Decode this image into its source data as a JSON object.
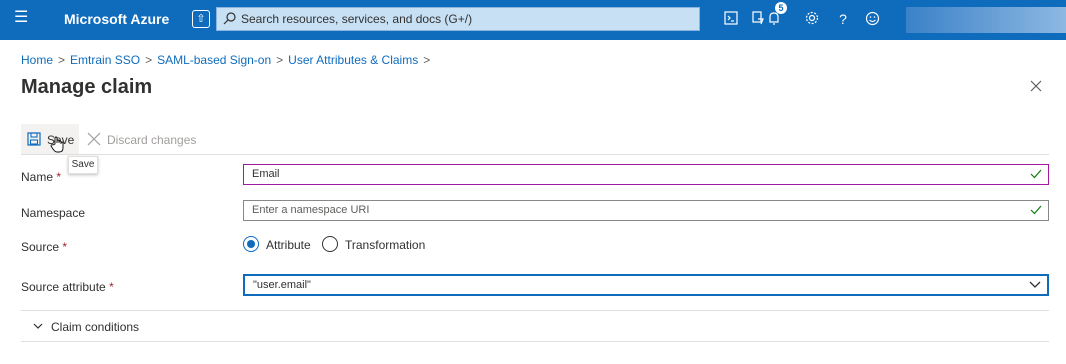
{
  "header": {
    "menu_icon": "hamburger-icon",
    "brand": "Microsoft Azure",
    "search_placeholder": "Search resources, services, and docs (G+/)",
    "notification_count": "5",
    "icons": [
      "cloud-shell-icon",
      "directory-filter-icon",
      "notifications-icon",
      "settings-icon",
      "help-icon",
      "feedback-icon"
    ]
  },
  "breadcrumb": {
    "items": [
      "Home",
      "Emtrain SSO",
      "SAML-based Sign-on",
      "User Attributes & Claims"
    ],
    "separator": ">"
  },
  "page": {
    "title": "Manage claim"
  },
  "toolbar": {
    "save_label": "Save",
    "discard_label": "Discard changes",
    "save_tooltip": "Save"
  },
  "form": {
    "name": {
      "label": "Name",
      "required_mark": "*",
      "value": "Email"
    },
    "namespace": {
      "label": "Namespace",
      "placeholder": "Enter a namespace URI"
    },
    "source": {
      "label": "Source",
      "required_mark": "*",
      "options": [
        "Attribute",
        "Transformation"
      ],
      "selected": "Attribute"
    },
    "source_attribute": {
      "label": "Source attribute",
      "required_mark": "*",
      "value": "\"user.email\""
    }
  },
  "claim_conditions": {
    "label": "Claim conditions"
  },
  "colors": {
    "accent": "#0f6cbd",
    "required": "#a4262c",
    "valid": "#107c10",
    "name_focus": "#a11ba0"
  }
}
